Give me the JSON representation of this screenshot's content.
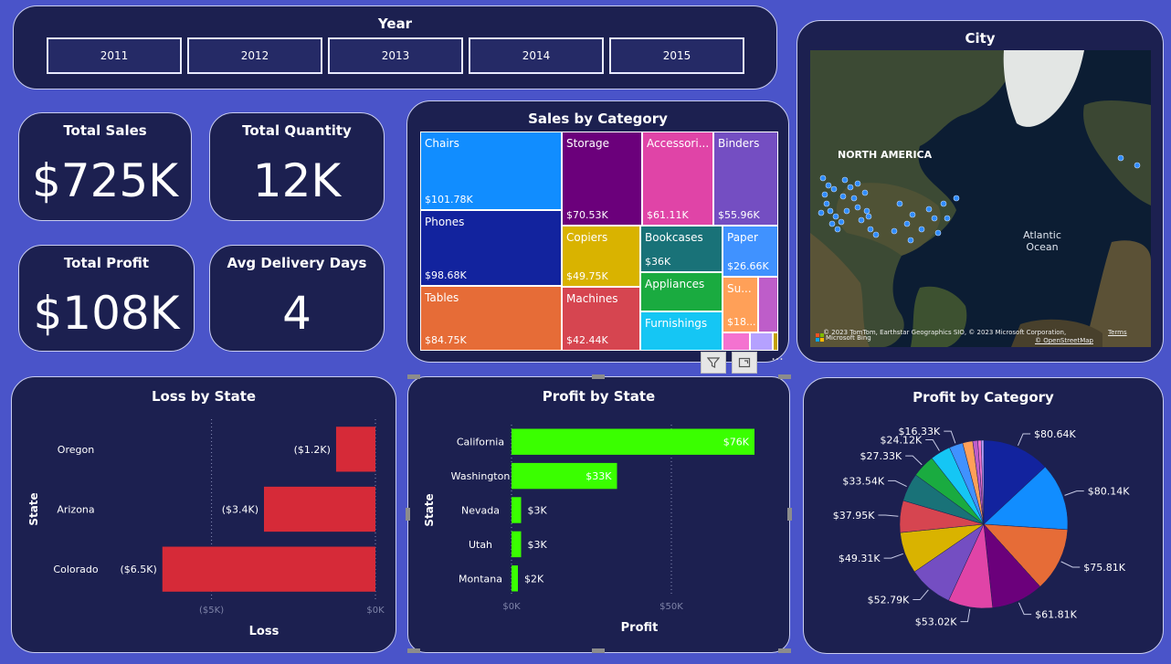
{
  "year_slicer": {
    "title": "Year",
    "years": [
      "2011",
      "2012",
      "2013",
      "2014",
      "2015"
    ]
  },
  "kpis": {
    "total_sales": {
      "title": "Total Sales",
      "value": "$725K"
    },
    "total_quantity": {
      "title": "Total Quantity",
      "value": "12K"
    },
    "total_profit": {
      "title": "Total Profit",
      "value": "$108K"
    },
    "avg_delivery": {
      "title": "Avg Delivery Days",
      "value": "4"
    }
  },
  "map": {
    "title": "City",
    "label_continent": "NORTH AMERICA",
    "label_ocean": "Atlantic\nOcean",
    "attribution": "© 2023 TomTom, Earthstar Geographics SIO, © 2023 Microsoft Corporation,",
    "terms": "Terms",
    "osm": "© OpenStreetMap",
    "bing": "Microsoft Bing"
  },
  "chart_data": [
    {
      "type": "treemap",
      "title": "Sales by Category",
      "items": [
        {
          "label": "Chairs",
          "value_label": "$101.78K",
          "value": 101.78,
          "color": "#118dff"
        },
        {
          "label": "Phones",
          "value_label": "$98.68K",
          "value": 98.68,
          "color": "#12239e"
        },
        {
          "label": "Tables",
          "value_label": "$84.75K",
          "value": 84.75,
          "color": "#e66c37"
        },
        {
          "label": "Storage",
          "value_label": "$70.53K",
          "value": 70.53,
          "color": "#6b007b"
        },
        {
          "label": "Accessori...",
          "value_label": "$61.11K",
          "value": 61.11,
          "color": "#e044a7"
        },
        {
          "label": "Binders",
          "value_label": "$55.96K",
          "value": 55.96,
          "color": "#744ec2"
        },
        {
          "label": "Copiers",
          "value_label": "$49.75K",
          "value": 49.75,
          "color": "#d9b300"
        },
        {
          "label": "Machines",
          "value_label": "$42.44K",
          "value": 42.44,
          "color": "#d64550"
        },
        {
          "label": "Bookcases",
          "value_label": "$36K",
          "value": 36,
          "color": "#197278"
        },
        {
          "label": "Appliances",
          "value_label": "",
          "value": 30,
          "color": "#1aab40"
        },
        {
          "label": "Furnishings",
          "value_label": "",
          "value": 28,
          "color": "#15c6f4"
        },
        {
          "label": "Paper",
          "value_label": "$26.66K",
          "value": 26.66,
          "color": "#4092ff"
        },
        {
          "label": "Su...",
          "value_label": "$18...",
          "value": 18,
          "color": "#ffa058"
        },
        {
          "label": "",
          "value_label": "",
          "value": 10,
          "color": "#be5dc9"
        },
        {
          "label": "",
          "value_label": "",
          "value": 8,
          "color": "#f472d0"
        },
        {
          "label": "",
          "value_label": "",
          "value": 7,
          "color": "#b5a1ff"
        },
        {
          "label": "",
          "value_label": "",
          "value": 3,
          "color": "#c4a200"
        }
      ]
    },
    {
      "type": "bar",
      "orientation": "horizontal",
      "title": "Loss by State",
      "xlabel": "Loss",
      "ylabel": "State",
      "categories": [
        "Oregon",
        "Arizona",
        "Colorado"
      ],
      "values": [
        -1.2,
        -3.4,
        -6.5
      ],
      "value_labels": [
        "($1.2K)",
        "($3.4K)",
        "($6.5K)"
      ],
      "xlim": [
        -6.8,
        0
      ],
      "ticks": [
        {
          "value": -5,
          "label": "($5K)"
        },
        {
          "value": 0,
          "label": "$0K"
        }
      ],
      "color": "#d62a38"
    },
    {
      "type": "bar",
      "orientation": "horizontal",
      "title": "Profit by State",
      "xlabel": "Profit",
      "ylabel": "State",
      "categories": [
        "California",
        "Washington",
        "Nevada",
        "Utah",
        "Montana"
      ],
      "values": [
        76,
        33,
        3,
        3,
        2
      ],
      "value_labels": [
        "$76K",
        "$33K",
        "$3K",
        "$3K",
        "$2K"
      ],
      "xlim": [
        0,
        80
      ],
      "ticks": [
        {
          "value": 0,
          "label": "$0K"
        },
        {
          "value": 50,
          "label": "$50K"
        }
      ],
      "color": "#3aff00"
    },
    {
      "type": "pie",
      "title": "Profit by Category",
      "slices": [
        {
          "value": 80.64,
          "label": "$80.64K",
          "color": "#12239e"
        },
        {
          "value": 80.14,
          "label": "$80.14K",
          "color": "#118dff"
        },
        {
          "value": 75.81,
          "label": "$75.81K",
          "color": "#e66c37"
        },
        {
          "value": 61.81,
          "label": "$61.81K",
          "color": "#6b007b"
        },
        {
          "value": 53.02,
          "label": "$53.02K",
          "color": "#e044a7"
        },
        {
          "value": 52.79,
          "label": "$52.79K",
          "color": "#744ec2"
        },
        {
          "value": 49.31,
          "label": "$49.31K",
          "color": "#d9b300"
        },
        {
          "value": 37.95,
          "label": "$37.95K",
          "color": "#d64550"
        },
        {
          "value": 33.54,
          "label": "$33.54K",
          "color": "#197278"
        },
        {
          "value": 27.33,
          "label": "$27.33K",
          "color": "#1aab40"
        },
        {
          "value": 24.12,
          "label": "$24.12K",
          "color": "#15c6f4"
        },
        {
          "value": 16.33,
          "label": "$16.33K",
          "color": "#4092ff"
        },
        {
          "value": 12,
          "label": "",
          "color": "#ffa058"
        },
        {
          "value": 6,
          "label": "",
          "color": "#be5dc9"
        },
        {
          "value": 4,
          "label": "",
          "color": "#f472d0"
        },
        {
          "value": 3,
          "label": "",
          "color": "#b5a1ff"
        }
      ]
    }
  ]
}
